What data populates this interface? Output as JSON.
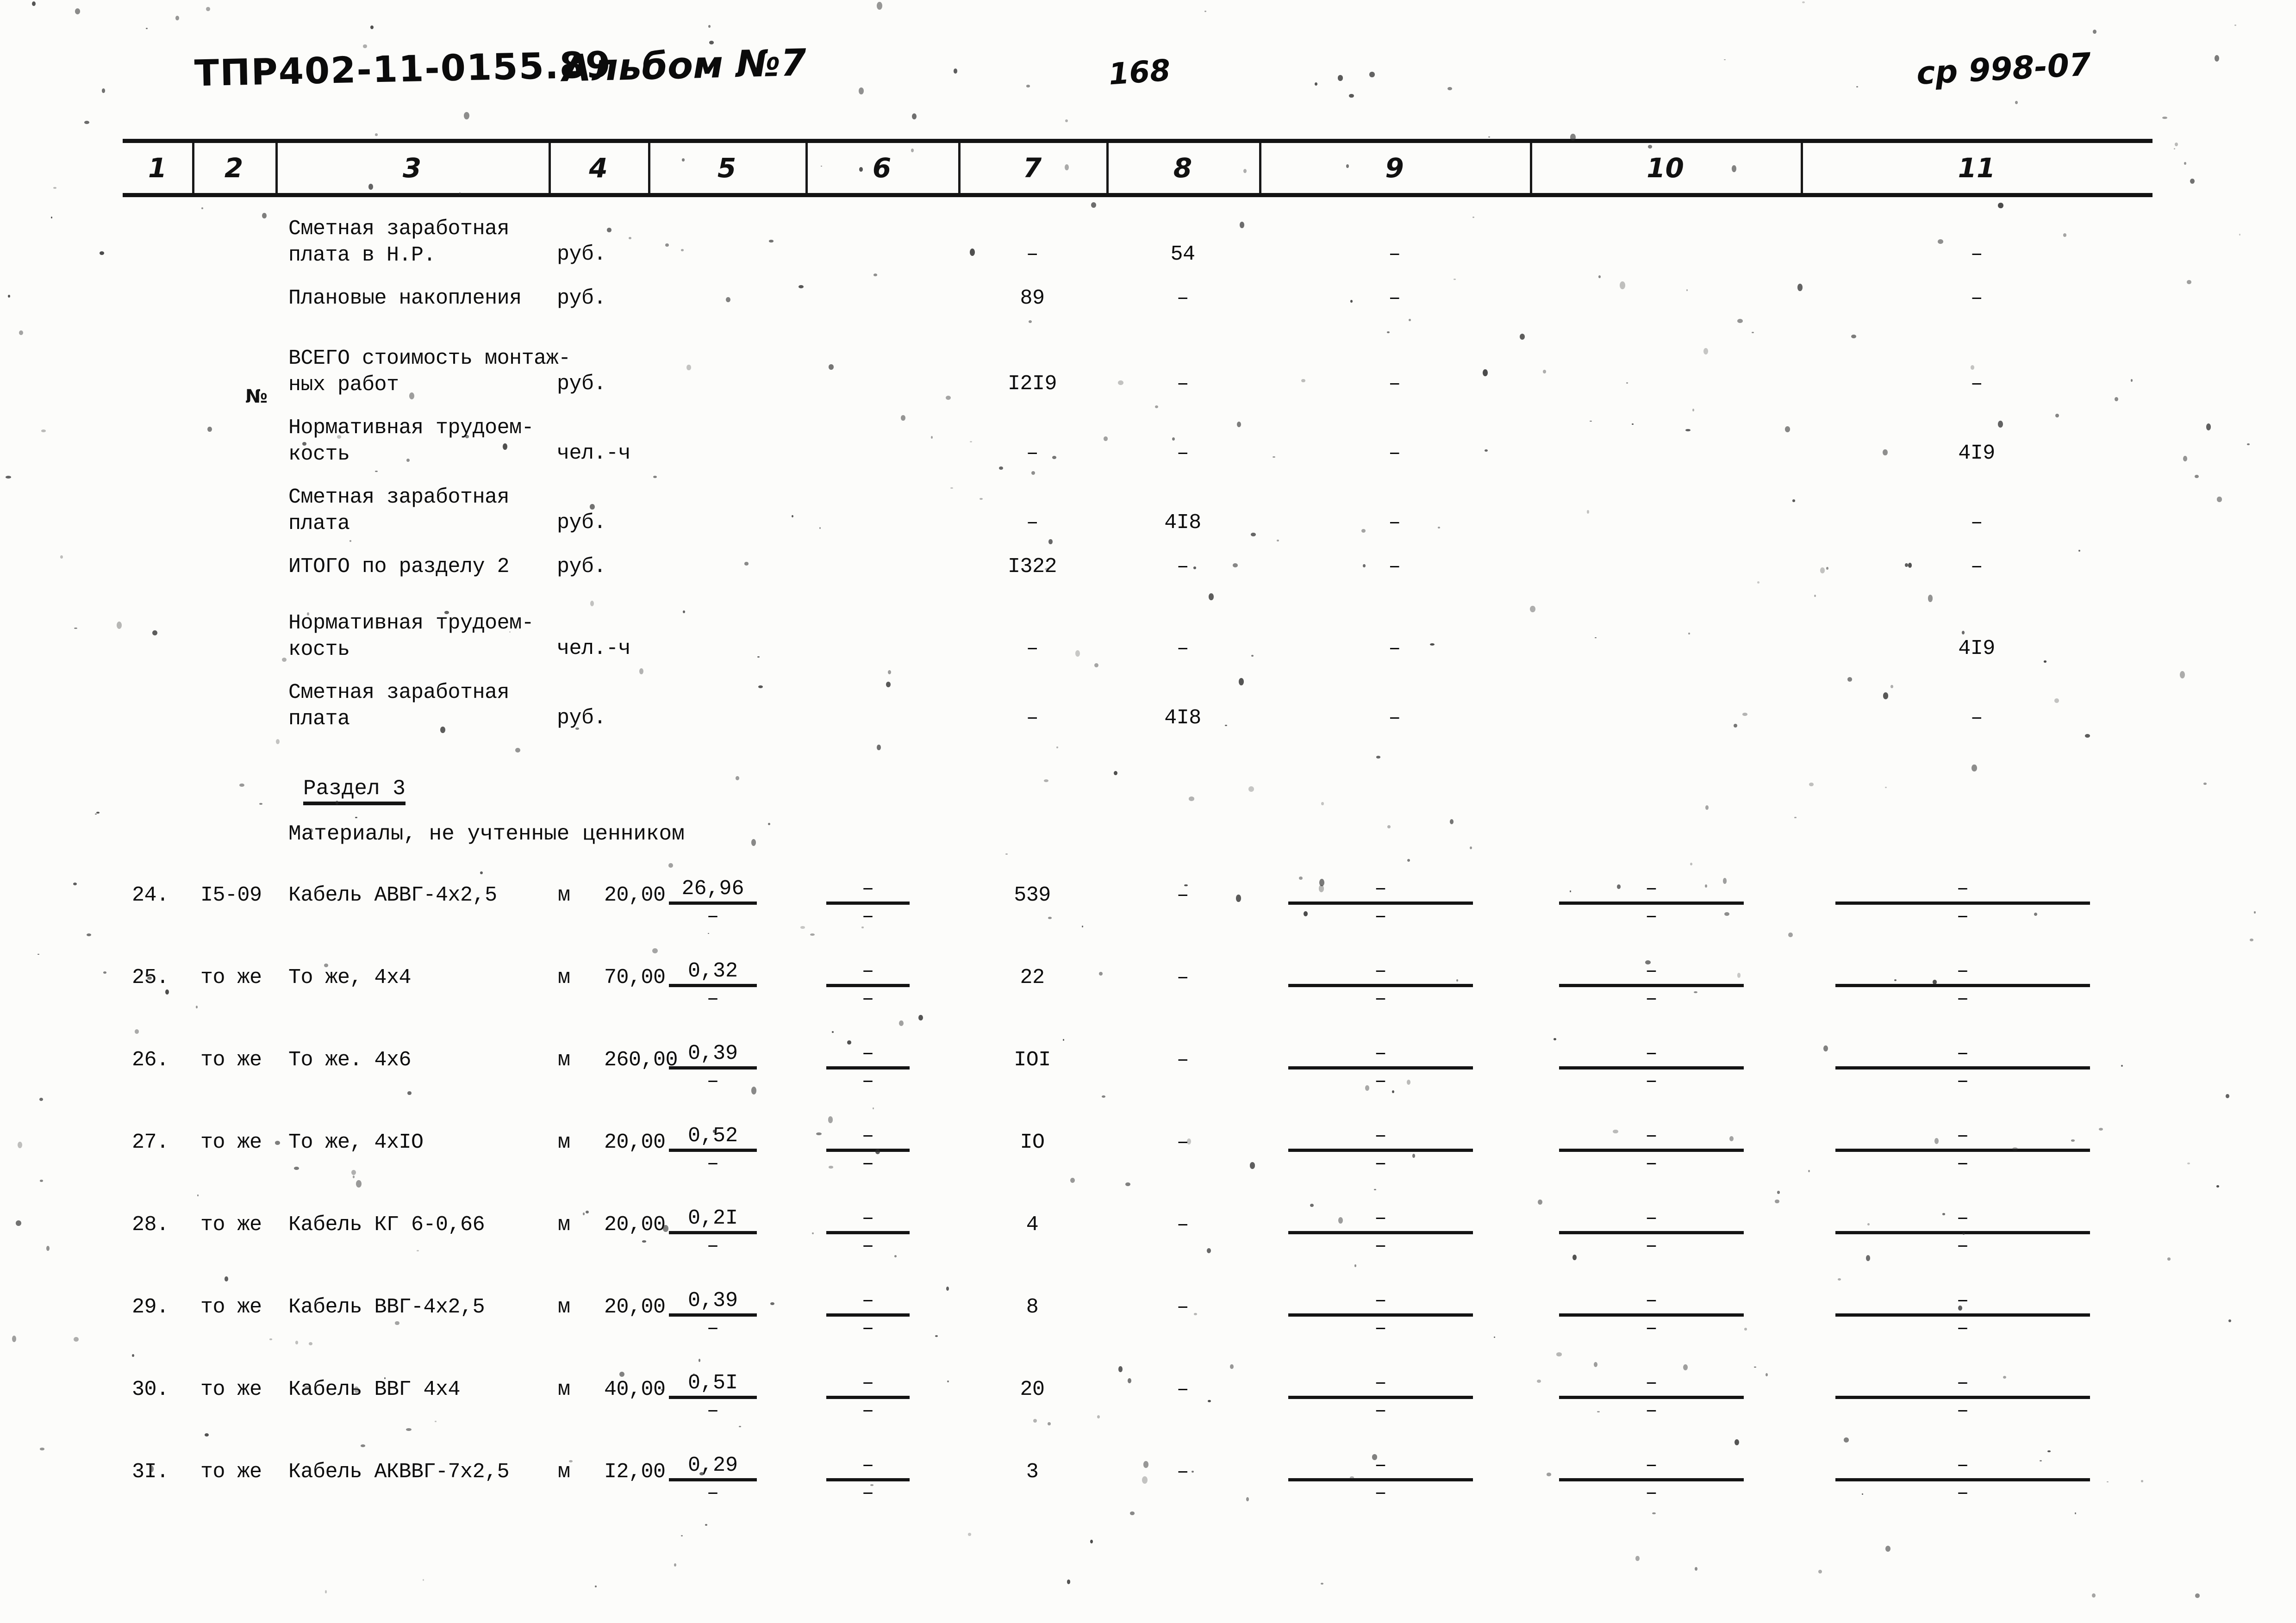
{
  "header": {
    "doc_code": "ТПР402-11-0155.89",
    "album": "Альбом №7",
    "page_number": "168",
    "sheet_code": "ср 998-07"
  },
  "table": {
    "column_numbers": [
      "1",
      "2",
      "3",
      "4",
      "5",
      "6",
      "7",
      "8",
      "9",
      "10",
      "11"
    ],
    "marker_col2": "№",
    "rows": [
      {
        "no": "",
        "code": "",
        "name": "Сметная заработная\nплата в Н.Р.",
        "unit": "руб.",
        "c5": "",
        "c6": "",
        "c7": "–",
        "c8": "54",
        "c9": "–",
        "c10": "",
        "c11": "–"
      },
      {
        "no": "",
        "code": "",
        "name": "Плановые накопления",
        "unit": "руб.",
        "c5": "",
        "c6": "",
        "c7": "89",
        "c8": "–",
        "c9": "–",
        "c10": "",
        "c11": "–"
      },
      {
        "no": "",
        "code": "",
        "name": "ВСЕГО стоимость монтаж-\nных работ",
        "unit": "руб.",
        "c5": "",
        "c6": "",
        "c7": "I2I9",
        "c8": "–",
        "c9": "–",
        "c10": "",
        "c11": "–"
      },
      {
        "no": "",
        "code": "",
        "name": "Нормативная трудоем-\nкость",
        "unit": "чел.-ч",
        "c5": "",
        "c6": "",
        "c7": "–",
        "c8": "–",
        "c9": "–",
        "c10": "",
        "c11": "4I9"
      },
      {
        "no": "",
        "code": "",
        "name": "Сметная заработная\nплата",
        "unit": "руб.",
        "c5": "",
        "c6": "",
        "c7": "–",
        "c8": "4I8",
        "c9": "–",
        "c10": "",
        "c11": "–"
      },
      {
        "no": "",
        "code": "",
        "name": "ИТОГО по разделу 2",
        "unit": "руб.",
        "c5": "",
        "c6": "",
        "c7": "I322",
        "c8": "–",
        "c9": "–",
        "c10": "",
        "c11": "–"
      },
      {
        "no": "",
        "code": "",
        "name": "Нормативная трудоем-\nкость",
        "unit": "чел.-ч",
        "c5": "",
        "c6": "",
        "c7": "–",
        "c8": "–",
        "c9": "–",
        "c10": "",
        "c11": "4I9"
      },
      {
        "no": "",
        "code": "",
        "name": "Сметная заработная\nплата",
        "unit": "руб.",
        "c5": "",
        "c6": "",
        "c7": "–",
        "c8": "4I8",
        "c9": "–",
        "c10": "",
        "c11": "–"
      }
    ],
    "section": {
      "title": "Раздел 3",
      "subtitle": "Материалы, не учтенные ценником"
    },
    "material_rows": [
      {
        "no": "24.",
        "code": "I5-09",
        "name": "Кабель АВВГ-4х2,5",
        "unit": "м",
        "qty": "20,00",
        "c5_num": "26,96",
        "c5_den": "–",
        "c6_num": "–",
        "c6_den": "–",
        "c7": "539",
        "c8": "–",
        "c9_num": "–",
        "c9_den": "–",
        "c10_num": "–",
        "c10_den": "–",
        "c11_num": "–",
        "c11_den": "–"
      },
      {
        "no": "25.",
        "code": "то же",
        "name": "То же, 4х4",
        "unit": "м",
        "qty": "70,00",
        "c5_num": "0,32",
        "c5_den": "–",
        "c6_num": "–",
        "c6_den": "–",
        "c7": "22",
        "c8": "–",
        "c9_num": "–",
        "c9_den": "–",
        "c10_num": "–",
        "c10_den": "–",
        "c11_num": "–",
        "c11_den": "–"
      },
      {
        "no": "26.",
        "code": "то же",
        "name": "То же. 4х6",
        "unit": "м",
        "qty": "260,00",
        "c5_num": "0,39",
        "c5_den": "–",
        "c6_num": "–",
        "c6_den": "–",
        "c7": "IOI",
        "c8": "–",
        "c9_num": "–",
        "c9_den": "–",
        "c10_num": "–",
        "c10_den": "–",
        "c11_num": "–",
        "c11_den": "–"
      },
      {
        "no": "27.",
        "code": "то же",
        "name": "То же, 4хIO",
        "unit": "м",
        "qty": "20,00",
        "c5_num": "0,52",
        "c5_den": "–",
        "c6_num": "–",
        "c6_den": "–",
        "c7": "IO",
        "c8": "–",
        "c9_num": "–",
        "c9_den": "–",
        "c10_num": "–",
        "c10_den": "–",
        "c11_num": "–",
        "c11_den": "–"
      },
      {
        "no": "28.",
        "code": "то же",
        "name": "Кабель КГ 6-0,66",
        "unit": "м",
        "qty": "20,00",
        "c5_num": "0,2I",
        "c5_den": "–",
        "c6_num": "–",
        "c6_den": "–",
        "c7": "4",
        "c8": "–",
        "c9_num": "–",
        "c9_den": "–",
        "c10_num": "–",
        "c10_den": "–",
        "c11_num": "–",
        "c11_den": "–"
      },
      {
        "no": "29.",
        "code": "то же",
        "name": "Кабель ВВГ-4х2,5",
        "unit": "м",
        "qty": "20,00",
        "c5_num": "0,39",
        "c5_den": "–",
        "c6_num": "–",
        "c6_den": "–",
        "c7": "8",
        "c8": "–",
        "c9_num": "–",
        "c9_den": "–",
        "c10_num": "–",
        "c10_den": "–",
        "c11_num": "–",
        "c11_den": "–"
      },
      {
        "no": "30.",
        "code": "то же",
        "name": "Кабель ВВГ 4х4",
        "unit": "м",
        "qty": "40,00",
        "c5_num": "0,5I",
        "c5_den": "–",
        "c6_num": "–",
        "c6_den": "–",
        "c7": "20",
        "c8": "–",
        "c9_num": "–",
        "c9_den": "–",
        "c10_num": "–",
        "c10_den": "–",
        "c11_num": "–",
        "c11_den": "–"
      },
      {
        "no": "3I.",
        "code": "то же",
        "name": "Кабель АКВВГ-7х2,5",
        "unit": "м",
        "qty": "I2,00",
        "c5_num": "0,29",
        "c5_den": "–",
        "c6_num": "–",
        "c6_den": "–",
        "c7": "3",
        "c8": "–",
        "c9_num": "–",
        "c9_den": "–",
        "c10_num": "–",
        "c10_den": "–",
        "c11_num": "–",
        "c11_den": "–"
      }
    ]
  }
}
